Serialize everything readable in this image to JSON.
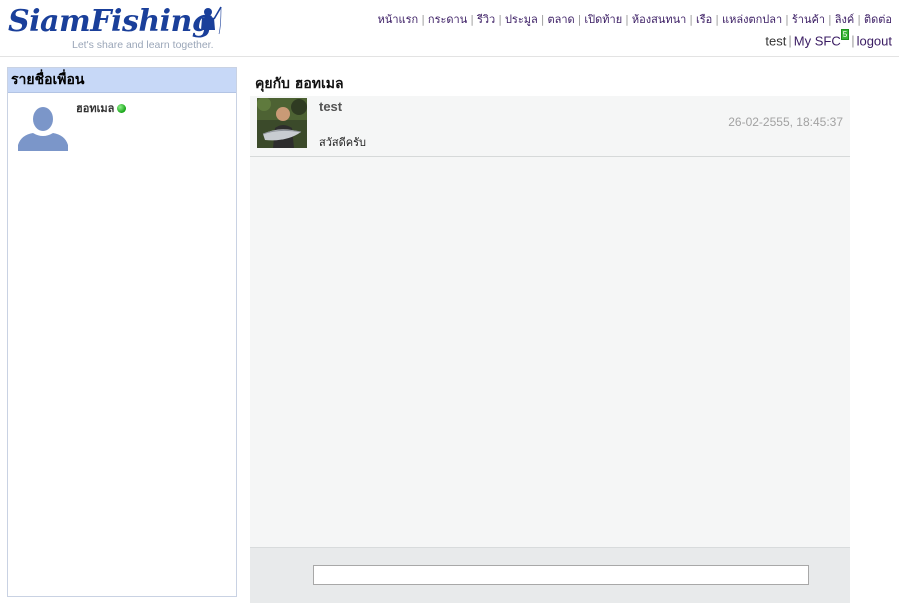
{
  "header": {
    "logo_text": "SiamFishing",
    "tagline": "Let's share and learn together.",
    "nav": [
      {
        "label": "หน้าแรก"
      },
      {
        "label": "กระดาน"
      },
      {
        "label": "รีวิว"
      },
      {
        "label": "ประมูล"
      },
      {
        "label": "ตลาด"
      },
      {
        "label": "เปิดท้าย"
      },
      {
        "label": "ห้องสนทนา"
      },
      {
        "label": "เรือ"
      },
      {
        "label": "แหล่งตกปลา"
      },
      {
        "label": "ร้านค้า"
      },
      {
        "label": "ลิงค์"
      },
      {
        "label": "ติดต่อ"
      }
    ],
    "user": {
      "username": "test",
      "my_sfc_label": "My SFC",
      "my_sfc_badge": "5",
      "logout_label": "logout"
    }
  },
  "sidebar": {
    "title": "รายชื่อเพื่อน",
    "friends": [
      {
        "name": "ฮอทเมล",
        "status": "online",
        "status_color": "#22b522"
      }
    ]
  },
  "chat": {
    "title": "คุยกับ ฮอทเมล",
    "messages": [
      {
        "sender": "test",
        "time": "26-02-2555, 18:45:37",
        "text": "สวัสดีครับ"
      }
    ],
    "input_value": ""
  },
  "colors": {
    "brand": "#1a3f9a",
    "nav_link": "#3a1c63",
    "sidebar_header": "#c7d8f7",
    "chat_bg": "#f5f6f6"
  }
}
